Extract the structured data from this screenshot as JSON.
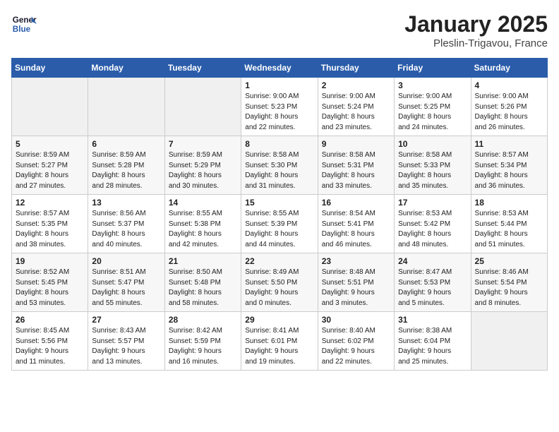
{
  "header": {
    "logo_line1": "General",
    "logo_line2": "Blue",
    "month": "January 2025",
    "location": "Pleslin-Trigavou, France"
  },
  "weekdays": [
    "Sunday",
    "Monday",
    "Tuesday",
    "Wednesday",
    "Thursday",
    "Friday",
    "Saturday"
  ],
  "weeks": [
    [
      {
        "day": "",
        "info": ""
      },
      {
        "day": "",
        "info": ""
      },
      {
        "day": "",
        "info": ""
      },
      {
        "day": "1",
        "info": "Sunrise: 9:00 AM\nSunset: 5:23 PM\nDaylight: 8 hours\nand 22 minutes."
      },
      {
        "day": "2",
        "info": "Sunrise: 9:00 AM\nSunset: 5:24 PM\nDaylight: 8 hours\nand 23 minutes."
      },
      {
        "day": "3",
        "info": "Sunrise: 9:00 AM\nSunset: 5:25 PM\nDaylight: 8 hours\nand 24 minutes."
      },
      {
        "day": "4",
        "info": "Sunrise: 9:00 AM\nSunset: 5:26 PM\nDaylight: 8 hours\nand 26 minutes."
      }
    ],
    [
      {
        "day": "5",
        "info": "Sunrise: 8:59 AM\nSunset: 5:27 PM\nDaylight: 8 hours\nand 27 minutes."
      },
      {
        "day": "6",
        "info": "Sunrise: 8:59 AM\nSunset: 5:28 PM\nDaylight: 8 hours\nand 28 minutes."
      },
      {
        "day": "7",
        "info": "Sunrise: 8:59 AM\nSunset: 5:29 PM\nDaylight: 8 hours\nand 30 minutes."
      },
      {
        "day": "8",
        "info": "Sunrise: 8:58 AM\nSunset: 5:30 PM\nDaylight: 8 hours\nand 31 minutes."
      },
      {
        "day": "9",
        "info": "Sunrise: 8:58 AM\nSunset: 5:31 PM\nDaylight: 8 hours\nand 33 minutes."
      },
      {
        "day": "10",
        "info": "Sunrise: 8:58 AM\nSunset: 5:33 PM\nDaylight: 8 hours\nand 35 minutes."
      },
      {
        "day": "11",
        "info": "Sunrise: 8:57 AM\nSunset: 5:34 PM\nDaylight: 8 hours\nand 36 minutes."
      }
    ],
    [
      {
        "day": "12",
        "info": "Sunrise: 8:57 AM\nSunset: 5:35 PM\nDaylight: 8 hours\nand 38 minutes."
      },
      {
        "day": "13",
        "info": "Sunrise: 8:56 AM\nSunset: 5:37 PM\nDaylight: 8 hours\nand 40 minutes."
      },
      {
        "day": "14",
        "info": "Sunrise: 8:55 AM\nSunset: 5:38 PM\nDaylight: 8 hours\nand 42 minutes."
      },
      {
        "day": "15",
        "info": "Sunrise: 8:55 AM\nSunset: 5:39 PM\nDaylight: 8 hours\nand 44 minutes."
      },
      {
        "day": "16",
        "info": "Sunrise: 8:54 AM\nSunset: 5:41 PM\nDaylight: 8 hours\nand 46 minutes."
      },
      {
        "day": "17",
        "info": "Sunrise: 8:53 AM\nSunset: 5:42 PM\nDaylight: 8 hours\nand 48 minutes."
      },
      {
        "day": "18",
        "info": "Sunrise: 8:53 AM\nSunset: 5:44 PM\nDaylight: 8 hours\nand 51 minutes."
      }
    ],
    [
      {
        "day": "19",
        "info": "Sunrise: 8:52 AM\nSunset: 5:45 PM\nDaylight: 8 hours\nand 53 minutes."
      },
      {
        "day": "20",
        "info": "Sunrise: 8:51 AM\nSunset: 5:47 PM\nDaylight: 8 hours\nand 55 minutes."
      },
      {
        "day": "21",
        "info": "Sunrise: 8:50 AM\nSunset: 5:48 PM\nDaylight: 8 hours\nand 58 minutes."
      },
      {
        "day": "22",
        "info": "Sunrise: 8:49 AM\nSunset: 5:50 PM\nDaylight: 9 hours\nand 0 minutes."
      },
      {
        "day": "23",
        "info": "Sunrise: 8:48 AM\nSunset: 5:51 PM\nDaylight: 9 hours\nand 3 minutes."
      },
      {
        "day": "24",
        "info": "Sunrise: 8:47 AM\nSunset: 5:53 PM\nDaylight: 9 hours\nand 5 minutes."
      },
      {
        "day": "25",
        "info": "Sunrise: 8:46 AM\nSunset: 5:54 PM\nDaylight: 9 hours\nand 8 minutes."
      }
    ],
    [
      {
        "day": "26",
        "info": "Sunrise: 8:45 AM\nSunset: 5:56 PM\nDaylight: 9 hours\nand 11 minutes."
      },
      {
        "day": "27",
        "info": "Sunrise: 8:43 AM\nSunset: 5:57 PM\nDaylight: 9 hours\nand 13 minutes."
      },
      {
        "day": "28",
        "info": "Sunrise: 8:42 AM\nSunset: 5:59 PM\nDaylight: 9 hours\nand 16 minutes."
      },
      {
        "day": "29",
        "info": "Sunrise: 8:41 AM\nSunset: 6:01 PM\nDaylight: 9 hours\nand 19 minutes."
      },
      {
        "day": "30",
        "info": "Sunrise: 8:40 AM\nSunset: 6:02 PM\nDaylight: 9 hours\nand 22 minutes."
      },
      {
        "day": "31",
        "info": "Sunrise: 8:38 AM\nSunset: 6:04 PM\nDaylight: 9 hours\nand 25 minutes."
      },
      {
        "day": "",
        "info": ""
      }
    ]
  ]
}
